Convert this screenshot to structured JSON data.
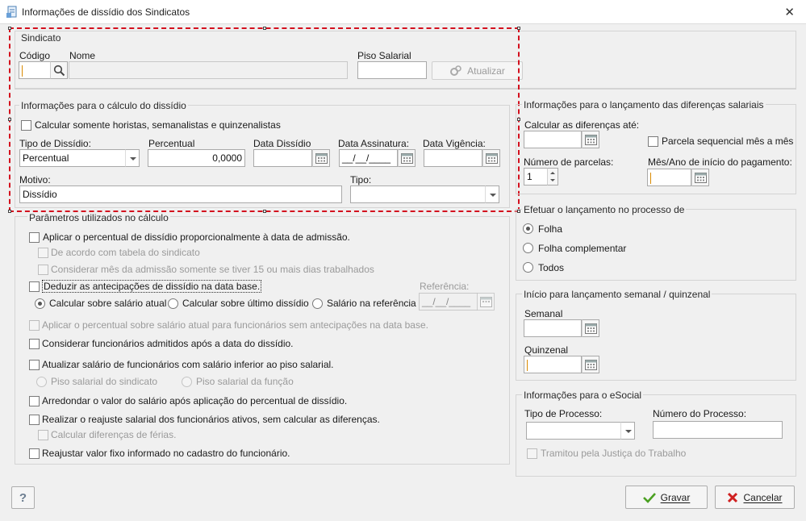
{
  "window": {
    "title": "Informações de dissídio dos Sindicatos",
    "icon": "app-doc-icon",
    "close": "✕"
  },
  "sindicato": {
    "group": "Sindicato",
    "codigo_label": "Código",
    "nome_label": "Nome",
    "piso_label": "Piso Salarial",
    "codigo_value": "",
    "nome_value": "",
    "piso_value": "",
    "atualizar_label": "Atualizar"
  },
  "calculo": {
    "group": "Informações para o cálculo do dissídio",
    "horistas_label": "Calcular somente horistas, semanalistas e quinzenalistas",
    "tipo_dissidio_label": "Tipo de Dissídio:",
    "tipo_dissidio_value": "Percentual",
    "percentual_label": "Percentual",
    "percentual_value": "0,0000",
    "data_dissidio_label": "Data Dissídio",
    "data_dissidio_value": "",
    "data_assinatura_label": "Data Assinatura:",
    "data_assinatura_value": "__/__/____",
    "data_vigencia_label": "Data Vigência:",
    "data_vigencia_value": "",
    "motivo_label": "Motivo:",
    "motivo_value": "Dissídio",
    "tipo_label": "Tipo:",
    "tipo_value": ""
  },
  "parametros": {
    "group": "Parâmetros utilizados no cálculo",
    "aplicar_proporcional": "Aplicar o percentual de dissídio proporcionalmente à data de admissão.",
    "tabela_sindicato": "De acordo com tabela do sindicato",
    "mes_admissao": "Considerar mês da admissão somente se tiver 15 ou mais dias trabalhados",
    "deduzir": "Deduzir as antecipações de dissídio na data base.",
    "referencia_label": "Referência:",
    "referencia_value": "__/__/____",
    "radio_atual": "Calcular sobre salário atual",
    "radio_ultimo": "Calcular sobre último dissídio",
    "radio_referencia": "Salário na referência",
    "aplicar_sem_antecipacoes": "Aplicar o percentual sobre salário atual para funcionários sem antecipações na data base.",
    "considerar_admitidos": "Considerar funcionários admitidos após a data do dissídio.",
    "atualizar_piso": "Atualizar salário de funcionários com salário inferior ao piso salarial.",
    "piso_sindicato": "Piso salarial do sindicato",
    "piso_funcao": "Piso salarial da função",
    "arredondar": "Arredondar o valor do salário após aplicação do percentual de dissídio.",
    "reajuste_ativos": "Realizar o reajuste salarial dos funcionários ativos, sem calcular as diferenças.",
    "diferencas_ferias": "Calcular diferenças de férias.",
    "reajustar_fixo": "Reajustar valor fixo informado no cadastro do funcionário."
  },
  "lancamento": {
    "group": "Informações para o lançamento das diferenças salariais",
    "calcular_ate_label": "Calcular as diferenças até:",
    "calcular_ate_value": "",
    "parcela_seq_label": "Parcela sequencial mês a mês",
    "num_parcelas_label": "Número de parcelas:",
    "num_parcelas_value": "1",
    "mes_ano_label": "Mês/Ano de início do pagamento:",
    "mes_ano_value": ""
  },
  "processo": {
    "group": "Efetuar o lançamento no processo de",
    "folha": "Folha",
    "folha_complementar": "Folha complementar",
    "todos": "Todos"
  },
  "semanal": {
    "group": "Início para lançamento semanal / quinzenal",
    "semanal_label": "Semanal",
    "semanal_value": "",
    "quinzenal_label": "Quinzenal",
    "quinzenal_value": ""
  },
  "esocial": {
    "group": "Informações para o eSocial",
    "tipo_processo_label": "Tipo de Processo:",
    "tipo_processo_value": "",
    "numero_processo_label": "Número do Processo:",
    "numero_processo_value": "",
    "tramitou_label": "Tramitou pela Justiça do Trabalho"
  },
  "footer": {
    "help": "?",
    "gravar": "Gravar",
    "cancelar": "Cancelar"
  },
  "colors": {
    "selection": "#d3101e",
    "ok": "#3b9a1a",
    "cancel": "#d02020"
  }
}
